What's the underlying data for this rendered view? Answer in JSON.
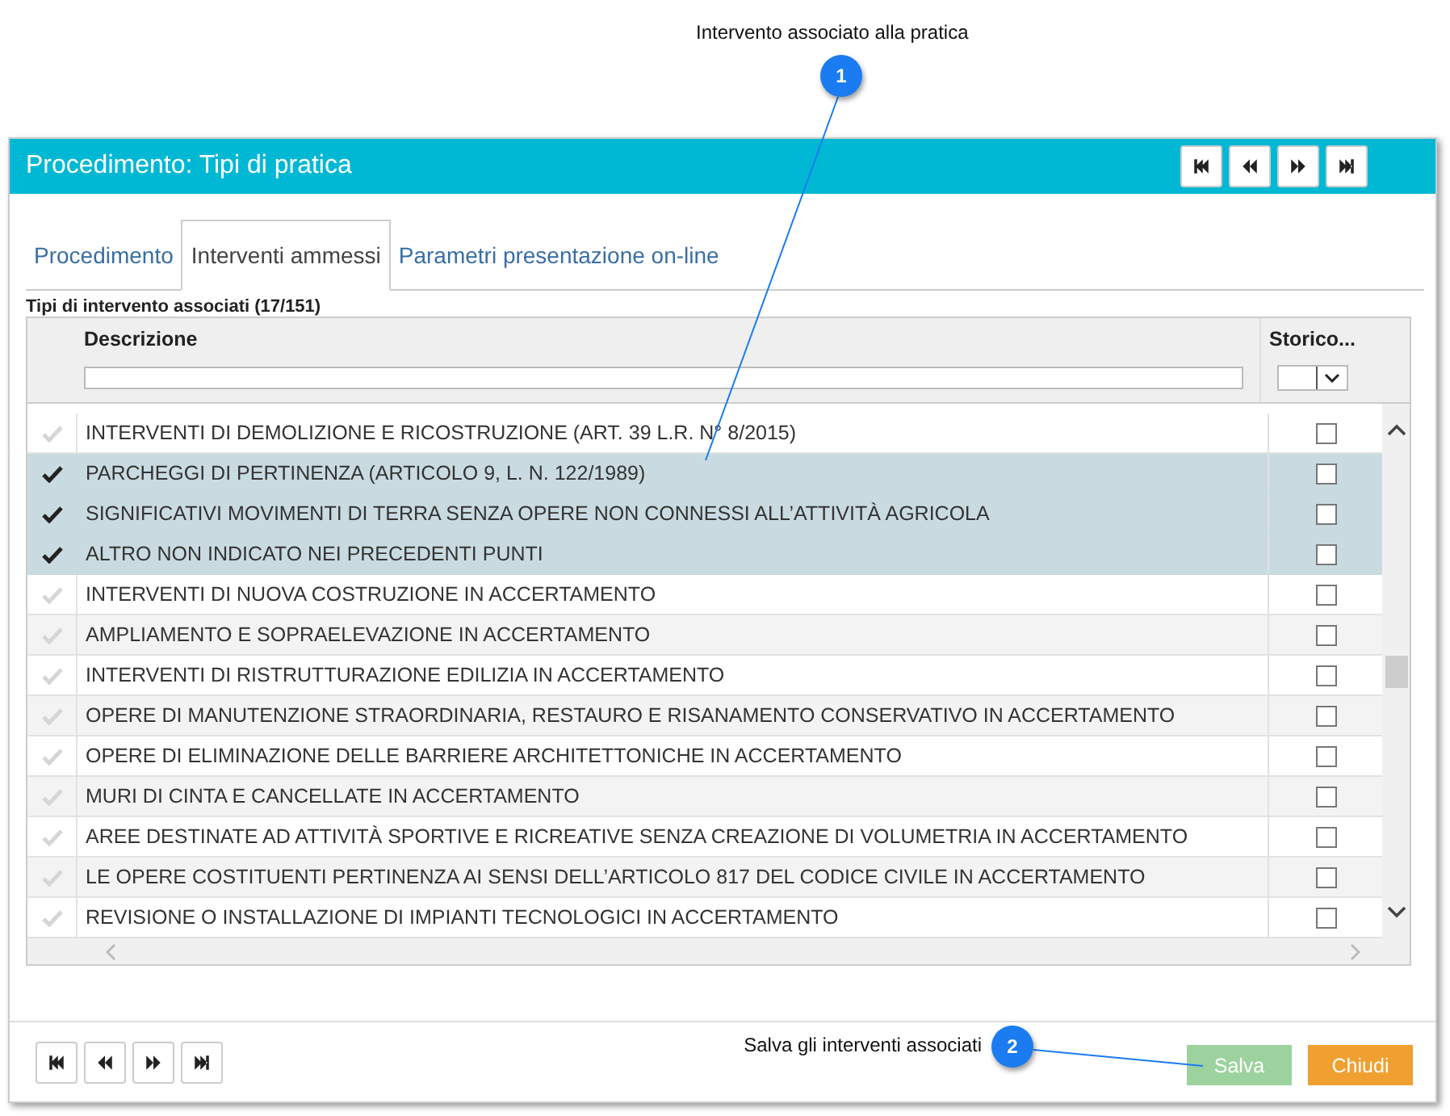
{
  "annotations": [
    {
      "number": "1",
      "text": "Intervento associato alla pratica"
    },
    {
      "number": "2",
      "text": "Salva gli interventi associati"
    }
  ],
  "window": {
    "title": "Procedimento: Tipi di pratica"
  },
  "tabs": [
    {
      "label": "Procedimento",
      "selected": false
    },
    {
      "label": "Interventi ammessi",
      "selected": true
    },
    {
      "label": "Parametri presentazione on-line",
      "selected": false
    }
  ],
  "grid": {
    "caption": "Tipi di intervento associati (17/151)",
    "columns": [
      "Descrizione",
      "Storico..."
    ],
    "rows": [
      {
        "description": "INTERVENTI DI DEMOLIZIONE E RICOSTRUZIONE (ART. 39 L.R. N° 8/2015)",
        "selected": false,
        "storico": false
      },
      {
        "description": "PARCHEGGI DI PERTINENZA (ARTICOLO 9, L. N. 122/1989)",
        "selected": true,
        "storico": false
      },
      {
        "description": "SIGNIFICATIVI MOVIMENTI DI TERRA SENZA OPERE NON CONNESSI ALL’ATTIVITÀ AGRICOLA",
        "selected": true,
        "storico": false
      },
      {
        "description": "ALTRO NON INDICATO NEI PRECEDENTI PUNTI",
        "selected": true,
        "storico": false
      },
      {
        "description": "INTERVENTI DI NUOVA COSTRUZIONE IN ACCERTAMENTO",
        "selected": false,
        "storico": false
      },
      {
        "description": "AMPLIAMENTO E SOPRAELEVAZIONE IN ACCERTAMENTO",
        "selected": false,
        "storico": false
      },
      {
        "description": "INTERVENTI DI RISTRUTTURAZIONE EDILIZIA IN ACCERTAMENTO",
        "selected": false,
        "storico": false
      },
      {
        "description": "OPERE DI MANUTENZIONE STRAORDINARIA, RESTAURO E RISANAMENTO CONSERVATIVO IN ACCERTAMENTO",
        "selected": false,
        "storico": false
      },
      {
        "description": "OPERE DI ELIMINAZIONE DELLE BARRIERE ARCHITETTONICHE IN ACCERTAMENTO",
        "selected": false,
        "storico": false
      },
      {
        "description": "MURI DI CINTA E CANCELLATE IN ACCERTAMENTO",
        "selected": false,
        "storico": false
      },
      {
        "description": "AREE DESTINATE AD ATTIVITÀ SPORTIVE E RICREATIVE SENZA CREAZIONE DI VOLUMETRIA IN ACCERTAMENTO",
        "selected": false,
        "storico": false
      },
      {
        "description": "LE OPERE COSTITUENTI PERTINENZA AI SENSI DELL’ARTICOLO 817 DEL CODICE CIVILE IN ACCERTAMENTO",
        "selected": false,
        "storico": false
      },
      {
        "description": "REVISIONE O INSTALLAZIONE DI IMPIANTI TECNOLOGICI IN ACCERTAMENTO",
        "selected": false,
        "storico": false
      }
    ]
  },
  "buttons": [
    {
      "label": "Salva",
      "kind": "save",
      "disabled": true
    },
    {
      "label": "Chiudi",
      "kind": "close",
      "disabled": false
    }
  ]
}
